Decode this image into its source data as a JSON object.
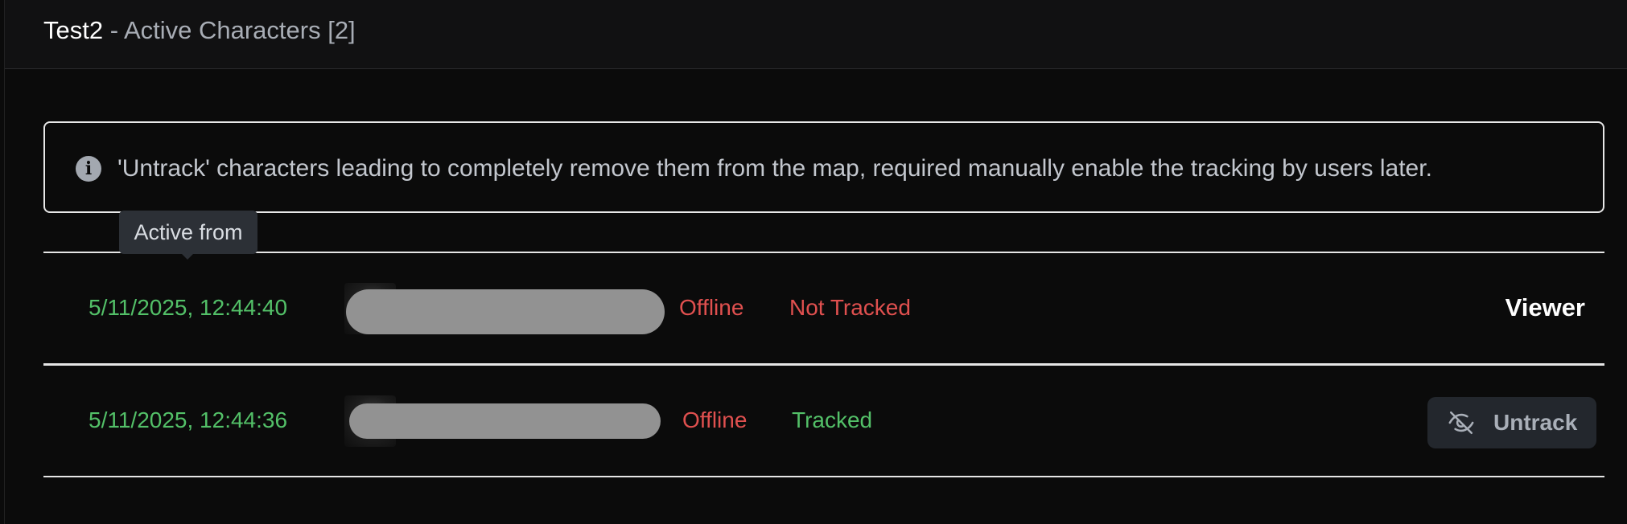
{
  "header": {
    "name": "Test2",
    "subtitle": " - Active Characters [2]"
  },
  "notice": {
    "icon": "info-icon",
    "text": "'Untrack' characters leading to completely remove them from the map, required manually enable the tracking by users later."
  },
  "tooltip": {
    "text": "Active from"
  },
  "characters": [
    {
      "active_from": "5/11/2025, 12:44:40",
      "status": "Offline",
      "tracking": "Not Tracked",
      "tracking_color": "#e0504f",
      "role": "Viewer"
    },
    {
      "active_from": "5/11/2025, 12:44:36",
      "status": "Offline",
      "tracking": "Tracked",
      "tracking_color": "#53c068",
      "action": {
        "icon": "eye-off-icon",
        "label": "Untrack"
      }
    }
  ],
  "colors": {
    "online_green": "#53c068",
    "offline_red": "#e0504f",
    "background": "#0b0b0b"
  }
}
